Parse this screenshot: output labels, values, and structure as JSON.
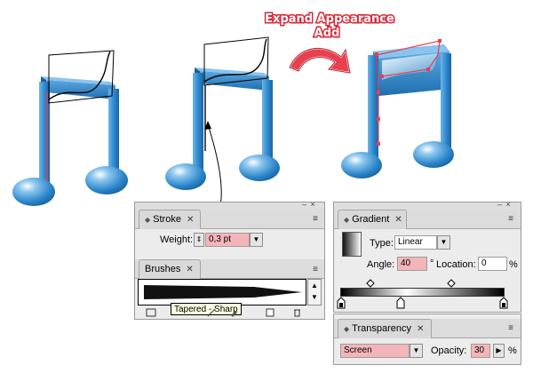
{
  "banner": {
    "line1": "Expand Appearance",
    "line2": "Add",
    "text_color": "#ffffff",
    "outline_color": "#d9273a"
  },
  "colors": {
    "note_blue": "#2c86c9",
    "note_dark": "#1a5f99",
    "anchor_red": "#e8404f",
    "panel_bg": "#ececec",
    "field_pink": "#f4b5b9"
  },
  "stroke_panel": {
    "tab_label": "Stroke",
    "close_icon": "close-icon",
    "menu_icon": "panel-menu-icon",
    "weight_label": "Weight:",
    "weight_value": "0,3 pt"
  },
  "brushes_panel": {
    "tab_label": "Brushes",
    "tooltip": "Tapered - Sharp"
  },
  "gradient_panel": {
    "tab_label": "Gradient",
    "type_label": "Type:",
    "type_value": "Linear",
    "angle_label": "Angle:",
    "angle_value": "40",
    "angle_unit": "°",
    "location_label": "Location:",
    "location_value": "0",
    "location_unit": "%"
  },
  "transparency_panel": {
    "tab_label": "Transparency",
    "mode_value": "Screen",
    "opacity_label": "Opacity:",
    "opacity_value": "30",
    "opacity_unit": "%"
  }
}
